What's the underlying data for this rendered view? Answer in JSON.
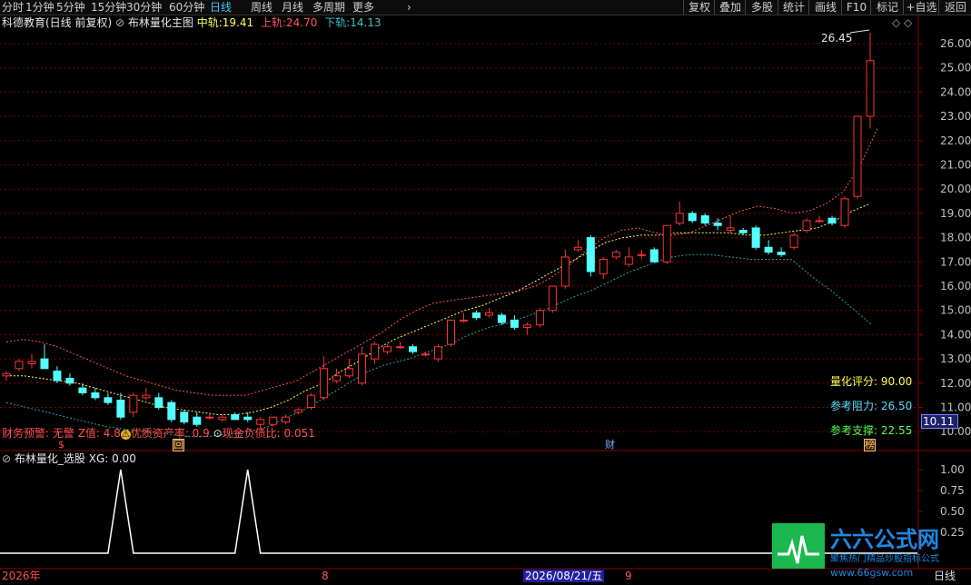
{
  "toolbar": {
    "periods": [
      "分时",
      "1分钟",
      "5分钟",
      "15分钟",
      "30分钟",
      "60分钟",
      "日线",
      "周线",
      "月线",
      "多周期",
      "更多"
    ],
    "active": "日线",
    "more_arrow": "›",
    "right": [
      "复权",
      "叠加",
      "多股",
      "统计",
      "画线",
      "F10",
      "标记",
      "+自选",
      "返回"
    ]
  },
  "main_header": {
    "title": "科德教育(日线 前复权)",
    "indicator": "布林量化主图",
    "mid_label": "中轨:",
    "mid_value": "19.41",
    "up_label": "上轨:",
    "up_value": "24.70",
    "down_label": "下轨:",
    "down_value": "14.13"
  },
  "price_axis": [
    "26.00",
    "25.00",
    "24.00",
    "23.00",
    "22.00",
    "21.00",
    "20.00",
    "19.00",
    "18.00",
    "17.00",
    "16.00",
    "15.00",
    "14.00",
    "13.00",
    "12.00",
    "11.00",
    "10.00"
  ],
  "current_price": "10.11",
  "high_marker": "26.45",
  "overlays": {
    "score_label": "量化评分:",
    "score_value": "90.00",
    "resist_label": "参考阻力:",
    "resist_value": "26.50",
    "support_label": "参考支撑:",
    "support_value": "22.55"
  },
  "finance_line": {
    "warn": "财务预警: 无警",
    "z": "Z值: 4.8",
    "quality": "优质资产率: 0.9",
    "cash": "现金负债比: 0.051"
  },
  "event_markers": {
    "s": "$",
    "hui": "回",
    "cai": "财",
    "bang": "榜"
  },
  "sub_header": {
    "name": "布林量化_选股",
    "xg": "XG: 0.00"
  },
  "sub_axis": [
    "1.00",
    "0.75",
    "0.50",
    "0.25"
  ],
  "date_axis": {
    "year": "2026年",
    "m8": "8",
    "cursor": "2026/08/21/五",
    "m9": "9",
    "period": "日线"
  },
  "watermark": {
    "brand": "六六公式网",
    "slogan": "聚焦热门精品炒股指标公式",
    "url": "www.66gsw.com"
  },
  "colors": {
    "up": "#ff3232",
    "down": "#54ffff",
    "ma_up": "#ff4f6a",
    "ma_mid": "#ffff54",
    "ma_dn": "#2aa3a3",
    "grid": "#7a0000"
  },
  "chart_data": {
    "type": "candlestick",
    "y_range": [
      9.5,
      26.5
    ],
    "candles": [
      [
        12.3,
        12.5,
        12.1,
        12.4
      ],
      [
        12.6,
        13.0,
        12.5,
        12.9
      ],
      [
        12.8,
        13.2,
        12.6,
        12.9
      ],
      [
        13.0,
        13.6,
        12.8,
        12.6
      ],
      [
        12.5,
        12.7,
        12.0,
        12.1
      ],
      [
        12.2,
        12.4,
        11.9,
        12.0
      ],
      [
        11.8,
        12.0,
        11.5,
        11.6
      ],
      [
        11.6,
        11.8,
        11.3,
        11.4
      ],
      [
        11.4,
        11.6,
        11.1,
        11.2
      ],
      [
        11.3,
        11.6,
        10.5,
        10.6
      ],
      [
        10.8,
        11.6,
        10.6,
        11.5
      ],
      [
        11.4,
        11.8,
        11.3,
        11.5
      ],
      [
        11.4,
        11.6,
        10.9,
        11.0
      ],
      [
        11.2,
        11.3,
        10.4,
        10.5
      ],
      [
        10.8,
        10.9,
        10.3,
        10.4
      ],
      [
        10.6,
        10.8,
        10.2,
        10.3
      ],
      [
        10.6,
        10.8,
        10.5,
        10.6
      ],
      [
        10.5,
        10.7,
        10.4,
        10.6
      ],
      [
        10.7,
        10.8,
        10.5,
        10.5
      ],
      [
        10.6,
        10.8,
        10.4,
        10.5
      ],
      [
        10.3,
        10.6,
        10.1,
        10.5
      ],
      [
        10.3,
        10.6,
        10.2,
        10.6
      ],
      [
        10.4,
        10.7,
        10.3,
        10.6
      ],
      [
        10.8,
        11.0,
        10.7,
        10.9
      ],
      [
        11.0,
        11.6,
        10.9,
        11.5
      ],
      [
        11.4,
        13.1,
        11.3,
        12.6
      ],
      [
        12.1,
        12.6,
        12.0,
        12.3
      ],
      [
        12.3,
        13.0,
        12.2,
        12.6
      ],
      [
        12.0,
        13.5,
        11.9,
        13.2
      ],
      [
        13.0,
        13.7,
        12.8,
        13.6
      ],
      [
        13.3,
        13.6,
        13.2,
        13.5
      ],
      [
        13.5,
        13.7,
        13.4,
        13.5
      ],
      [
        13.5,
        13.6,
        13.2,
        13.3
      ],
      [
        13.2,
        13.3,
        13.1,
        13.2
      ],
      [
        13.0,
        13.6,
        12.9,
        13.5
      ],
      [
        13.6,
        14.6,
        13.5,
        14.6
      ],
      [
        14.6,
        14.9,
        14.5,
        14.6
      ],
      [
        14.9,
        15.0,
        14.6,
        14.7
      ],
      [
        14.8,
        15.1,
        14.7,
        14.9
      ],
      [
        14.8,
        14.9,
        14.4,
        14.5
      ],
      [
        14.6,
        14.8,
        14.2,
        14.3
      ],
      [
        14.3,
        14.5,
        14.0,
        14.4
      ],
      [
        14.4,
        15.1,
        14.3,
        15.0
      ],
      [
        15.0,
        16.0,
        14.9,
        16.0
      ],
      [
        16.0,
        17.5,
        15.9,
        17.2
      ],
      [
        17.5,
        17.9,
        17.4,
        17.6
      ],
      [
        18.0,
        18.1,
        16.4,
        16.6
      ],
      [
        16.5,
        17.2,
        16.3,
        17.1
      ],
      [
        17.2,
        17.5,
        17.1,
        17.4
      ],
      [
        16.9,
        17.6,
        16.8,
        17.2
      ],
      [
        17.3,
        17.5,
        17.1,
        17.3
      ],
      [
        17.5,
        17.6,
        17.0,
        17.0
      ],
      [
        17.0,
        18.5,
        16.9,
        18.5
      ],
      [
        18.6,
        19.5,
        18.5,
        19.0
      ],
      [
        19.0,
        19.1,
        18.6,
        18.7
      ],
      [
        18.9,
        19.0,
        18.5,
        18.6
      ],
      [
        18.6,
        18.8,
        18.3,
        18.5
      ],
      [
        18.3,
        18.9,
        18.2,
        18.4
      ],
      [
        18.3,
        18.4,
        18.1,
        18.2
      ],
      [
        18.4,
        18.5,
        17.5,
        17.6
      ],
      [
        17.6,
        17.9,
        17.3,
        17.4
      ],
      [
        17.4,
        17.6,
        17.2,
        17.3
      ],
      [
        17.6,
        18.2,
        17.5,
        18.1
      ],
      [
        18.3,
        18.8,
        18.2,
        18.7
      ],
      [
        18.7,
        18.9,
        18.6,
        18.7
      ],
      [
        18.8,
        18.9,
        18.5,
        18.6
      ],
      [
        18.5,
        19.7,
        18.4,
        19.6
      ],
      [
        19.7,
        23.0,
        19.6,
        23.0
      ],
      [
        23.0,
        26.45,
        22.5,
        25.3
      ]
    ],
    "series": [
      {
        "values": [
          13.7,
          13.8,
          13.7,
          13.5,
          13.2,
          12.9,
          12.6,
          12.3,
          12.1,
          11.9,
          11.7,
          11.6,
          11.5,
          11.5,
          11.5,
          11.7,
          11.9,
          12.1,
          12.5,
          12.9,
          13.3,
          13.7,
          14.1,
          14.6,
          15.0,
          15.3,
          15.4,
          15.5,
          15.6,
          15.7,
          15.8,
          16.0,
          16.4,
          16.9,
          17.5,
          18.0,
          18.3,
          18.4,
          18.2,
          18.1,
          18.2,
          18.5,
          18.8,
          19.1,
          19.3,
          19.2,
          19.0,
          19.1,
          19.4,
          19.9,
          21.0,
          22.5
        ]
      },
      {
        "values": [
          12.3,
          12.3,
          12.2,
          12.1,
          12.0,
          11.8,
          11.6,
          11.4,
          11.2,
          11.0,
          10.9,
          10.8,
          10.7,
          10.7,
          10.8,
          11.0,
          11.3,
          11.7,
          12.0,
          12.5,
          12.9,
          13.4,
          13.8,
          14.1,
          14.4,
          14.7,
          15.0,
          15.2,
          15.5,
          15.8,
          16.2,
          16.6,
          17.0,
          17.4,
          17.8,
          18.0,
          18.1,
          18.1,
          18.2,
          18.2,
          18.2,
          18.2,
          18.1,
          18.1,
          18.2,
          18.3,
          18.4,
          18.7,
          19.1,
          19.4
        ]
      },
      {
        "values": [
          11.2,
          11.0,
          10.8,
          10.6,
          10.4,
          10.2,
          10.1,
          10.0,
          9.9,
          9.8,
          9.8,
          9.9,
          10.0,
          10.2,
          10.6,
          11.0,
          11.5,
          12.0,
          12.5,
          12.8,
          13.0,
          13.3,
          13.6,
          14.0,
          14.3,
          14.5,
          14.8,
          15.1,
          15.5,
          15.8,
          16.2,
          16.6,
          16.9,
          17.2,
          17.3,
          17.3,
          17.2,
          17.1,
          17.1,
          17.1,
          16.4,
          15.8,
          15.1,
          14.4
        ]
      }
    ],
    "xg": [
      0,
      0,
      0,
      0,
      0,
      0,
      0,
      0,
      0,
      1,
      0,
      0,
      0,
      0,
      0,
      0,
      0,
      0,
      0,
      1,
      0,
      0,
      0,
      0,
      0,
      0,
      0,
      0,
      0,
      0,
      0,
      0,
      0,
      0,
      0,
      0,
      0,
      0,
      0,
      0,
      0,
      0,
      0,
      0,
      0,
      0,
      0,
      0,
      0,
      0,
      0,
      0,
      0,
      0,
      0,
      0,
      0,
      0,
      0,
      0,
      0,
      0,
      0,
      0,
      0,
      0,
      0,
      0,
      0
    ]
  }
}
